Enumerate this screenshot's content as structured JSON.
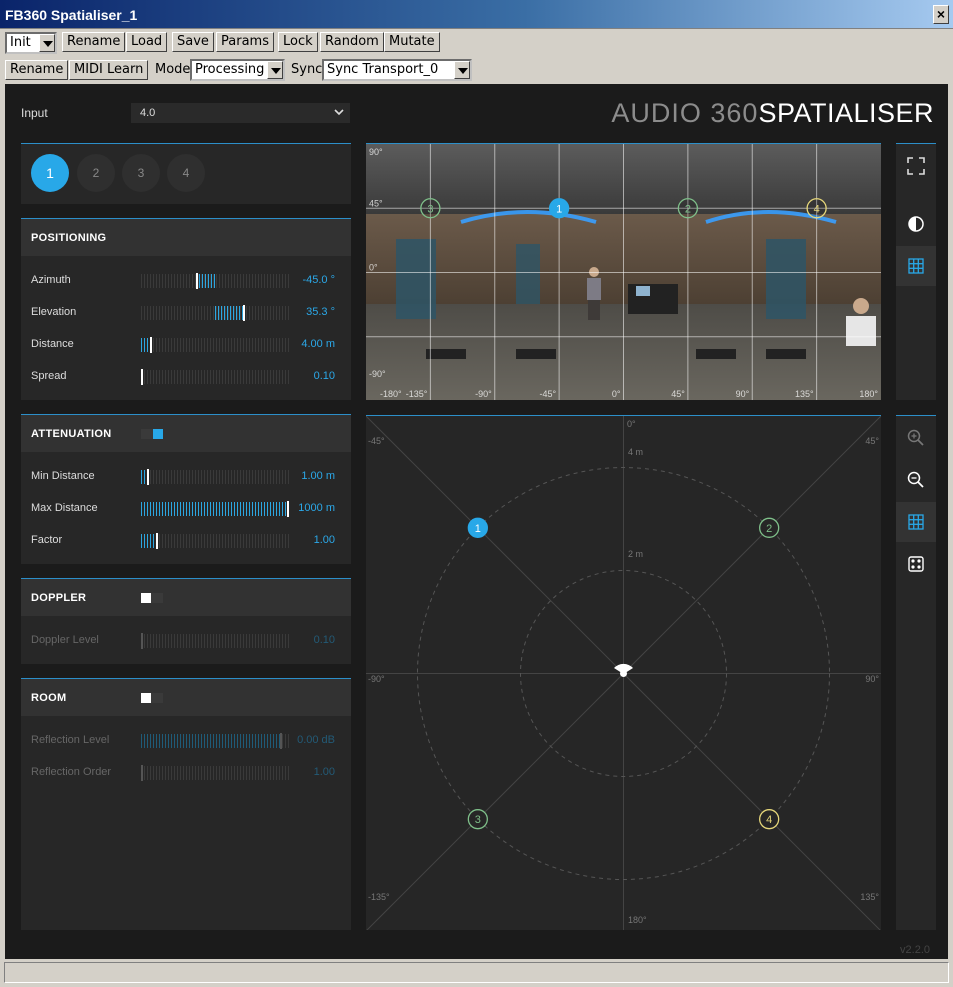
{
  "window": {
    "title": "FB360 Spatialiser_1",
    "close_label": "×"
  },
  "toolbar1": {
    "preset_value": "Init",
    "buttons": [
      "Rename",
      "Load",
      "Save",
      "Params",
      "Lock",
      "Random",
      "Mutate"
    ]
  },
  "toolbar2": {
    "rename_label": "Rename",
    "midi_learn_label": "MIDI Learn",
    "mode_label": "Mode",
    "mode_value": "Processing",
    "sync_label": "Sync",
    "sync_value": "Sync Transport_0"
  },
  "plugin": {
    "input_label": "Input",
    "input_value": "4.0",
    "logo_thin": "AUDIO 360",
    "logo_bold": "SPATIALISER",
    "version": "v2.2.0"
  },
  "sources": {
    "labels": [
      "1",
      "2",
      "3",
      "4"
    ],
    "selected": "1"
  },
  "positioning": {
    "title": "POSITIONING",
    "rows": [
      {
        "label": "Azimuth",
        "value": "-45.0 °",
        "level": 0.38,
        "fill_mode": "left-of-center"
      },
      {
        "label": "Elevation",
        "value": "35.3 °",
        "level": 0.7,
        "fill_mode": "right-of-center"
      },
      {
        "label": "Distance",
        "value": "4.00 m",
        "level": 0.06,
        "fill_mode": "from-start"
      },
      {
        "label": "Spread",
        "value": "0.10",
        "level": 0.0,
        "fill_mode": "from-start"
      }
    ]
  },
  "attenuation": {
    "title": "ATTENUATION",
    "enabled": true,
    "rows": [
      {
        "label": "Min Distance",
        "value": "1.00 m",
        "level": 0.04
      },
      {
        "label": "Max Distance",
        "value": "1000 m",
        "level": 1.0
      },
      {
        "label": "Factor",
        "value": "1.00",
        "level": 0.1
      }
    ]
  },
  "doppler": {
    "title": "DOPPLER",
    "enabled": false,
    "rows": [
      {
        "label": "Doppler Level",
        "value": "0.10",
        "level": 0.0
      }
    ]
  },
  "room": {
    "title": "ROOM",
    "enabled": false,
    "rows": [
      {
        "label": "Reflection Level",
        "value": "0.00 dB",
        "level": 0.95
      },
      {
        "label": "Reflection Order",
        "value": "1.00",
        "level": 0.0
      }
    ]
  },
  "video": {
    "elev_labels": [
      "90°",
      "45°",
      "0°",
      "-90°"
    ],
    "azim_labels": [
      "-180°",
      "-135°",
      "-90°",
      "-45°",
      "0°",
      "45°",
      "90°",
      "135°",
      "180°"
    ],
    "markers": [
      {
        "label": "3",
        "az": -135,
        "el": 45
      },
      {
        "label": "1",
        "az": -45,
        "el": 45
      },
      {
        "label": "2",
        "az": 45,
        "el": 45
      },
      {
        "label": "4",
        "az": 135,
        "el": 45
      }
    ]
  },
  "topview": {
    "angle_labels": {
      "top": "0°",
      "top_left": "-45°",
      "top_right": "45°",
      "left": "-90°",
      "right": "90°",
      "bottom_left": "-135°",
      "bottom_right": "135°",
      "bottom": "180°"
    },
    "ring_labels": [
      "4 m",
      "2 m"
    ],
    "markers": [
      {
        "label": "1",
        "az": -45
      },
      {
        "label": "2",
        "az": 45
      },
      {
        "label": "3",
        "az": -135
      },
      {
        "label": "4",
        "az": 135
      }
    ]
  },
  "colors": {
    "accent": "#28a8e8",
    "marker_green": "#7fc08a",
    "marker_yellow": "#e6d77a"
  },
  "icons": {
    "fullscreen": "fullscreen-icon",
    "contrast": "contrast-icon",
    "grid": "grid-icon",
    "zoom_in": "zoom-in-icon",
    "zoom_out": "zoom-out-icon",
    "dots": "speaker-layout-icon"
  }
}
